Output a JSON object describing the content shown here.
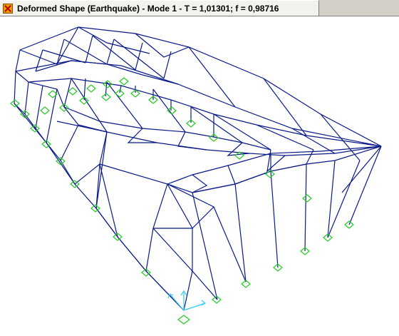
{
  "window": {
    "title": "Deformed Shape (Earthquake) - Mode 1 - T = 1,01301;  f = 0,98716",
    "icon": "structure-app-icon"
  },
  "view": {
    "frame_color": "#0a1a8a",
    "support_color": "#22cc22",
    "axis_color": "#33ccee",
    "background": "#ffffff"
  }
}
